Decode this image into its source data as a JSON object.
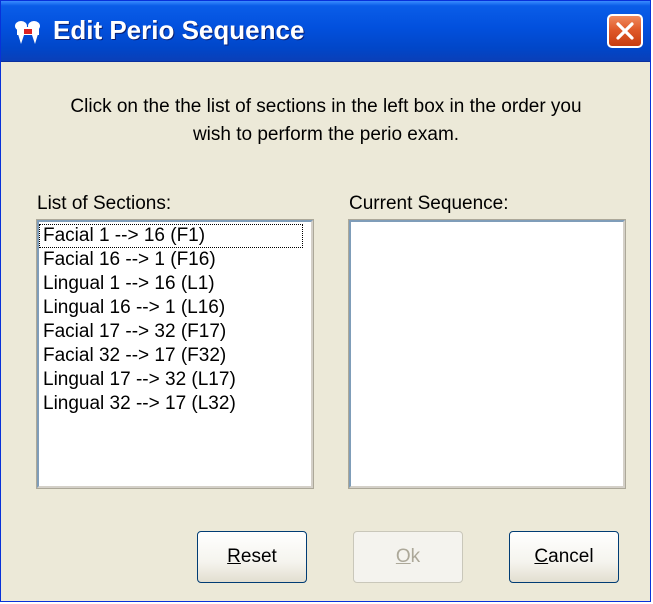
{
  "window": {
    "title": "Edit Perio Sequence",
    "app_icon": "dental-app-icon",
    "close_icon": "close-icon"
  },
  "instruction": {
    "line1": "Click on the the list of sections in the left box in the order you",
    "line2": "wish to perform the perio exam."
  },
  "sections_list": {
    "label": "List of Sections:",
    "items": [
      "Facial 1 --> 16 (F1)",
      "Facial 16 --> 1 (F16)",
      "Lingual 1 --> 16 (L1)",
      "Lingual 16 --> 1 (L16)",
      "Facial 17 --> 32 (F17)",
      "Facial 32 --> 17 (F32)",
      "Lingual 17 --> 32 (L17)",
      "Lingual 32 --> 17 (L32)"
    ]
  },
  "current_sequence": {
    "label": "Current Sequence:",
    "items": []
  },
  "buttons": {
    "reset": {
      "mnemonic": "R",
      "rest": "eset"
    },
    "ok": {
      "mnemonic": "O",
      "rest": "k",
      "enabled": false
    },
    "cancel": {
      "mnemonic": "C",
      "rest": "ancel"
    }
  },
  "colors": {
    "title_bar": "#0250dd",
    "dialog_bg": "#ece9d8",
    "close_button": "#e05a2a"
  }
}
